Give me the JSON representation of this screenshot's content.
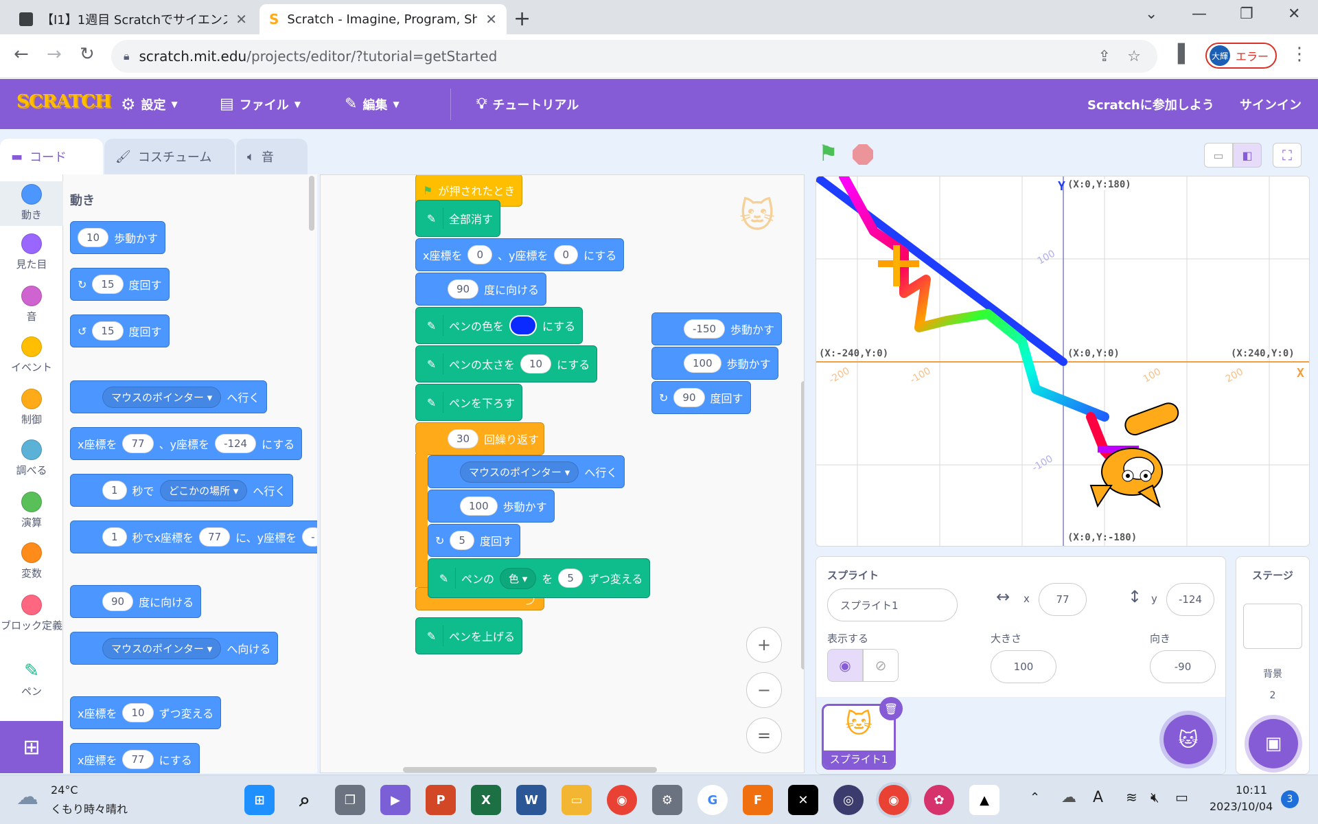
{
  "browser": {
    "tabs": [
      {
        "title": "【I1】1週目 Scratchでサイエンスアート",
        "close": "✕"
      },
      {
        "title": "Scratch - Imagine, Program, Share",
        "close": "✕"
      }
    ],
    "new_tab": "+",
    "url_host": "scratch.mit.edu",
    "url_path": "/projects/editor/?tutorial=getStarted",
    "profile_avatar": "大輝",
    "profile_label": "エラー"
  },
  "menubar": {
    "logo": "SCRATCH",
    "settings": "設定",
    "file": "ファイル",
    "edit": "編集",
    "tutorial": "チュートリアル",
    "join": "Scratchに参加しよう",
    "signin": "サインイン"
  },
  "editor_tabs": {
    "code": "コード",
    "costume": "コスチューム",
    "sound": "音"
  },
  "categories": [
    {
      "label": "動き",
      "color": "#4c97ff"
    },
    {
      "label": "見た目",
      "color": "#9966ff"
    },
    {
      "label": "音",
      "color": "#cf63cf"
    },
    {
      "label": "イベント",
      "color": "#ffbf00"
    },
    {
      "label": "制御",
      "color": "#ffab19"
    },
    {
      "label": "調べる",
      "color": "#5cb1d6"
    },
    {
      "label": "演算",
      "color": "#59c059"
    },
    {
      "label": "変数",
      "color": "#ff8c1a"
    },
    {
      "label": "ブロック定義",
      "color": "#ff6680"
    },
    {
      "label": "ペン",
      "color": "#0fbd8c"
    }
  ],
  "palette": {
    "heading": "動き",
    "move_val": "10",
    "move_txt": "歩動かす",
    "turn_r_val": "15",
    "turn_r_txt": "度回す",
    "turn_l_val": "15",
    "turn_l_txt": "度回す",
    "goto_drop": "マウスのポインター",
    "goto_txt": "へ行く",
    "setxy_a": "x座標を",
    "setxy_x": "77",
    "setxy_b": "、y座標を",
    "setxy_y": "-124",
    "setxy_c": "にする",
    "glide_sec": "1",
    "glide_a": "秒で",
    "glide_drop": "どこかの場所",
    "glide_b": "へ行く",
    "glide2_sec": "1",
    "glide2_a": "秒でx座標を",
    "glide2_x": "77",
    "glide2_b": "に、y座標を",
    "point_val": "90",
    "point_txt": "度に向ける",
    "pointto_drop": "マウスのポインター",
    "pointto_txt": "へ向ける",
    "changex_a": "x座標を",
    "changex_val": "10",
    "changex_b": "ずつ変える",
    "setx_a": "x座標を",
    "setx_val": "77",
    "setx_b": "にする"
  },
  "script": {
    "hat": "が押されたとき",
    "clear": "全部消す",
    "setxy_a": "x座標を",
    "setxy_x": "0",
    "setxy_b": "、y座標を",
    "setxy_y": "0",
    "setxy_c": "にする",
    "point_val": "90",
    "point_txt": "度に向ける",
    "pencolor_a": "ペンの色を",
    "pencolor_b": "にする",
    "pencolor_swatch": "#0a2aff",
    "pensize_a": "ペンの太さを",
    "pensize_val": "10",
    "pensize_b": "にする",
    "pendown": "ペンを下ろす",
    "repeat_val": "30",
    "repeat_txt": "回繰り返す",
    "goto_drop": "マウスのポインター",
    "goto_txt": "へ行く",
    "move_val": "100",
    "move_txt": "歩動かす",
    "turn_val": "5",
    "turn_txt": "度回す",
    "changecolor_a": "ペンの",
    "changecolor_drop": "色",
    "changecolor_b": "を",
    "changecolor_val": "5",
    "changecolor_c": "ずつ変える",
    "penup": "ペンを上げる"
  },
  "loose_script": {
    "move1_val": "-150",
    "move1_txt": "歩動かす",
    "move2_val": "100",
    "move2_txt": "歩動かす",
    "turn_val": "90",
    "turn_txt": "度回す"
  },
  "zoom": {
    "in": "+",
    "out": "−",
    "reset": "="
  },
  "stage": {
    "axis_y": "Y",
    "axis_x": "X",
    "top": "(X:0,Y:180)",
    "origin": "(X:0,Y:0)",
    "left": "(X:-240,Y:0)",
    "right": "(X:240,Y:0)",
    "bottom": "(X:0,Y:-180)",
    "ticks_x": [
      "-200",
      "-100",
      "100",
      "200"
    ],
    "ticks_y": [
      "100",
      "-100"
    ]
  },
  "sprite_info": {
    "heading": "スプライト",
    "name": "スプライト1",
    "x_label": "x",
    "x": "77",
    "y_label": "y",
    "y": "-124",
    "show_label": "表示する",
    "size_label": "大きさ",
    "size": "100",
    "direction_label": "向き",
    "direction": "-90",
    "thumb_label": "スプライト1"
  },
  "stage_pane": {
    "heading": "ステージ",
    "backdrop_label": "背景",
    "backdrop_count": "2"
  },
  "taskbar": {
    "temp": "24°C",
    "weather": "くもり時々晴れ",
    "time": "10:11",
    "date": "2023/10/04",
    "notif": "3",
    "ime": "A"
  }
}
